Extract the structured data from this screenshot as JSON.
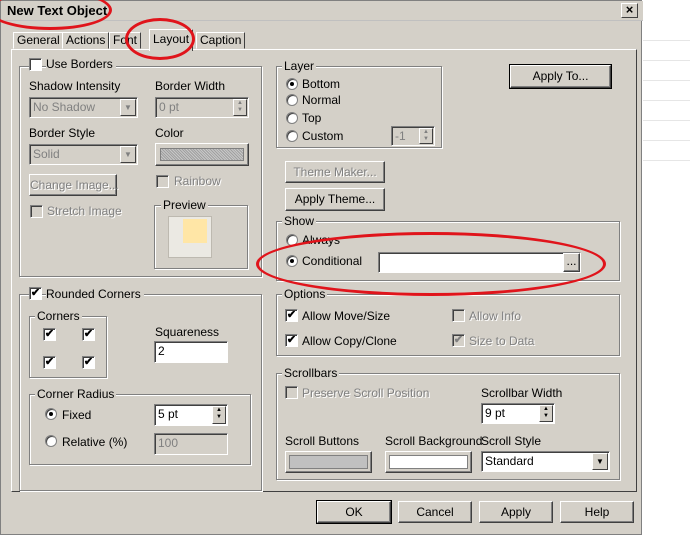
{
  "window": {
    "title": "New Text Object",
    "close_glyph": "×"
  },
  "tabs": [
    {
      "label": "General"
    },
    {
      "label": "Actions"
    },
    {
      "label": "Font"
    },
    {
      "label": "Layout",
      "active": true
    },
    {
      "label": "Caption"
    }
  ],
  "borders": {
    "use_borders_label": "Use Borders",
    "shadow_intensity_label": "Shadow Intensity",
    "shadow_intensity_value": "No Shadow",
    "border_width_label": "Border Width",
    "border_width_value": "0 pt",
    "border_style_label": "Border Style",
    "border_style_value": "Solid",
    "color_label": "Color",
    "change_image_label": "Change Image...",
    "rainbow_label": "Rainbow",
    "stretch_image_label": "Stretch Image",
    "preview_label": "Preview"
  },
  "rounded": {
    "rounded_corners_label": "Rounded Corners",
    "corners_label": "Corners",
    "check_glyph": "✔",
    "squareness_label": "Squareness",
    "squareness_value": "2",
    "corner_radius_label": "Corner Radius",
    "fixed_label": "Fixed",
    "fixed_value": "5 pt",
    "relative_label": "Relative (%)",
    "relative_value": "100"
  },
  "layer": {
    "legend": "Layer",
    "bottom_label": "Bottom",
    "normal_label": "Normal",
    "top_label": "Top",
    "custom_label": "Custom",
    "custom_value": "-1"
  },
  "apply_to_label": "Apply To...",
  "theme": {
    "theme_maker_label": "Theme Maker...",
    "apply_theme_label": "Apply Theme..."
  },
  "show": {
    "legend": "Show",
    "always_label": "Always",
    "conditional_label": "Conditional",
    "conditional_value": "",
    "ellipsis_label": "..."
  },
  "options": {
    "legend": "Options",
    "allow_move_size_label": "Allow Move/Size",
    "allow_info_label": "Allow Info",
    "allow_copy_clone_label": "Allow Copy/Clone",
    "size_to_data_label": "Size to Data"
  },
  "scrollbars": {
    "legend": "Scrollbars",
    "preserve_label": "Preserve Scroll Position",
    "scrollbar_width_label": "Scrollbar Width",
    "scrollbar_width_value": "9 pt",
    "scroll_buttons_label": "Scroll Buttons",
    "scroll_background_label": "Scroll Background",
    "scroll_style_label": "Scroll Style",
    "scroll_style_value": "Standard"
  },
  "footer": {
    "ok_label": "OK",
    "cancel_label": "Cancel",
    "apply_label": "Apply",
    "help_label": "Help"
  },
  "colors": {
    "dialog_bg": "#d4d0c8",
    "annotation_red": "#e0141b",
    "preview_fill": "#ffe6a6",
    "scroll_buttons_color": "#c0c0c0"
  }
}
